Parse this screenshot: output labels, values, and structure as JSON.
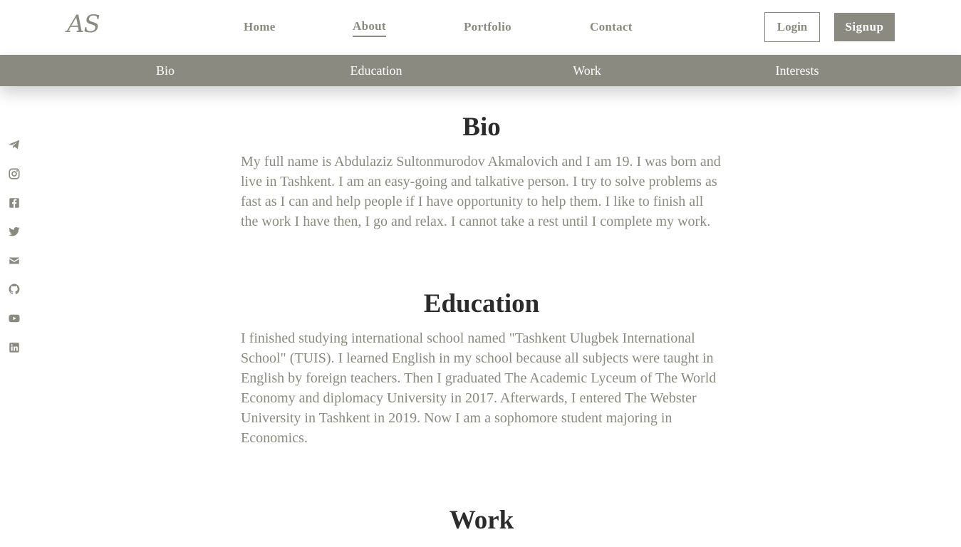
{
  "header": {
    "logo": "AS",
    "nav": {
      "home": "Home",
      "about": "About",
      "portfolio": "Portfolio",
      "contact": "Contact"
    },
    "login_label": "Login",
    "signup_label": "Signup"
  },
  "subnav": {
    "bio": "Bio",
    "education": "Education",
    "work": "Work",
    "interests": "Interests"
  },
  "social_icons": [
    "telegram-icon",
    "instagram-icon",
    "facebook-icon",
    "twitter-icon",
    "mail-icon",
    "github-icon",
    "youtube-icon",
    "linkedin-icon"
  ],
  "sections": {
    "bio": {
      "title": "Bio",
      "text": "My full name is Abdulaziz Sultonmurodov Akmalovich and I am 19. I was born and live in Tashkent. I am an easy-going and talkative person. I try to solve problems as fast as I can and help people if I have opportunity to help them. I like to finish all the work I have then, I go and relax. I cannot take a rest until I complete my work."
    },
    "education": {
      "title": "Education",
      "text": "I finished studying international school named \"Tashkent Ulugbek International School\" (TUIS). I learned English in my school because all subjects were taught in English by foreign teachers. Then I graduated The Academic Lyceum of The World Economy and diplomacy University in 2017. Afterwards, I entered The Webster University in Tashkent in 2019. Now I am a sophomore student majoring in Economics."
    },
    "work": {
      "title": "Work"
    }
  },
  "colors": {
    "accent": "#8a8a80",
    "heading": "#2b2b2b",
    "background": "#ffffff"
  }
}
